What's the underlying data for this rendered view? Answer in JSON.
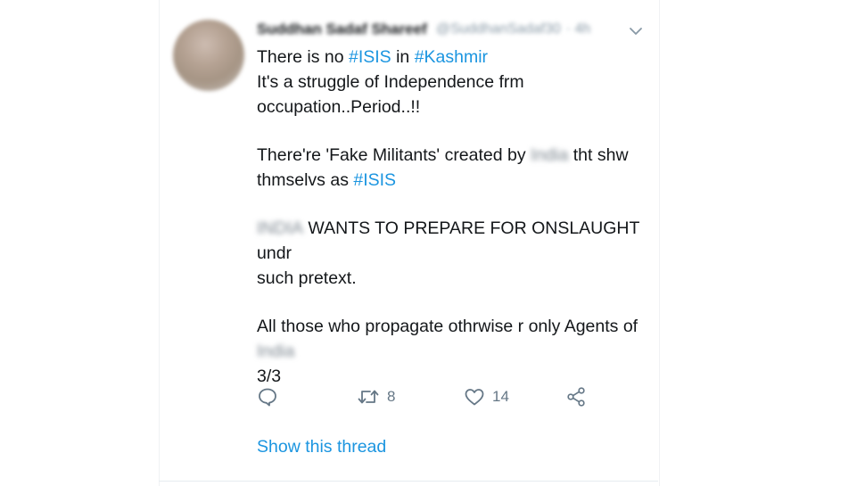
{
  "tweet": {
    "author_name": "Suddhan Sadaf Shareef",
    "author_handle": "@SuddhanSadaf30",
    "timestamp": "· 4h",
    "lines": {
      "l1_prefix": "There is no ",
      "l1_tag1": "#ISIS",
      "l1_mid": " in ",
      "l1_tag2": "#Kashmir",
      "l2": "It's a struggle of Independence frm",
      "l3": "occupation..Period..!!",
      "l4_prefix": "There're 'Fake Militants' created by ",
      "l4_blur": "India",
      "l4_suffix": " tht shw",
      "l5_prefix": "thmselvs as ",
      "l5_tag": "#ISIS",
      "l6_blur": "INDIA",
      "l6_suffix": " WANTS TO PREPARE FOR ONSLAUGHT undr",
      "l7": "such pretext.",
      "l8": "All those who propagate othrwise r only Agents of",
      "l9_blur": "India",
      "l10": "3/3"
    },
    "actions": {
      "retweet_count": "8",
      "like_count": "14"
    },
    "show_thread_label": "Show this thread"
  },
  "colors": {
    "link": "#1b95e0",
    "text": "#14171a",
    "muted": "#657786"
  },
  "icons": [
    "avatar",
    "chevron-down-icon",
    "reply-icon",
    "retweet-icon",
    "like-icon",
    "share-icon"
  ]
}
